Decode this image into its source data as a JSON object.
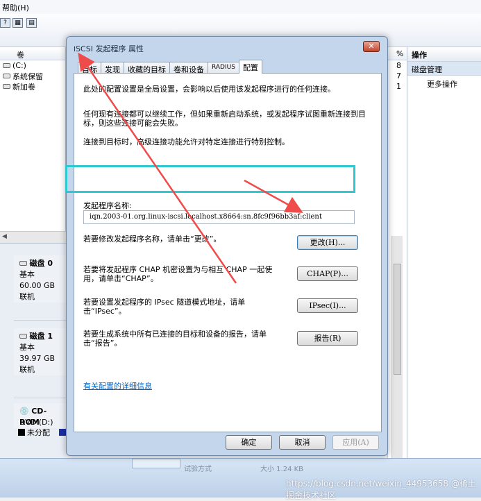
{
  "menu": {
    "help": "帮助(H)"
  },
  "toolbar": {
    "icons": [
      "help-icon",
      "properties-icon",
      "refresh-icon"
    ]
  },
  "volume_list": {
    "header": "卷",
    "items": [
      "(C:)",
      "系统保留",
      "新加卷"
    ]
  },
  "disks": [
    {
      "name": "磁盘 0",
      "type": "基本",
      "size": "60.00 GB",
      "status": "联机"
    },
    {
      "name": "磁盘 1",
      "type": "基本",
      "size": "39.97 GB",
      "status": "联机"
    },
    {
      "name": "CD-ROM",
      "type": "DVD (D:)",
      "size": "",
      "status": ""
    }
  ],
  "legend": {
    "unallocated": "未分配"
  },
  "columns": {
    "header": "%",
    "values": [
      "8",
      "7",
      "1"
    ]
  },
  "actions": {
    "title": "操作",
    "selected": "磁盘管理",
    "more": "更多操作"
  },
  "taskbar": {
    "item1": "试验方式",
    "item2": "大小 1.24 KB"
  },
  "dialog": {
    "title": "iSCSI 发起程序 属性",
    "close": "✕",
    "tabs": [
      "目标",
      "发现",
      "收藏的目标",
      "卷和设备",
      "RADIUS",
      "配置"
    ],
    "active_tab": "配置",
    "text_global": "此处的配置设置是全局设置，会影响以后使用该发起程序进行的任何连接。",
    "text_existing": "任何现有连接都可以继续工作，但如果重新启动系统，或发起程序试图重新连接到目标，则这些连接可能会失败。",
    "text_advanced": "连接到目标时，高级连接功能允许对特定连接进行特别控制。",
    "name_label": "发起程序名称:",
    "name_value": "iqn.2003-01.org.linux-iscsi.localhost.x8664:sn.8fc9f96bb3af:client",
    "text_change": "若要修改发起程序名称，请单击“更改”。",
    "btn_change": "更改(H)...",
    "text_chap": "若要将发起程序 CHAP 机密设置为与相互 CHAP 一起使用，请单击“CHAP”。",
    "btn_chap": "CHAP(P)...",
    "text_ipsec": "若要设置发起程序的 IPsec 隧道模式地址，请单击“IPsec”。",
    "btn_ipsec": "IPsec(I)...",
    "text_report": "若要生成系统中所有已连接的目标和设备的报告，请单击“报告”。",
    "btn_report": "报告(R)",
    "help_link": "有关配置的详细信息",
    "btn_ok": "确定",
    "btn_cancel": "取消",
    "btn_apply": "应用(A)"
  },
  "watermark": "https://blog.csdn.net/weixin_44953658 @稀土掘金技术社区",
  "colors": {
    "highlight": "#2cc9d1",
    "arrow": "#ef4b4b",
    "link": "#0066cc"
  }
}
